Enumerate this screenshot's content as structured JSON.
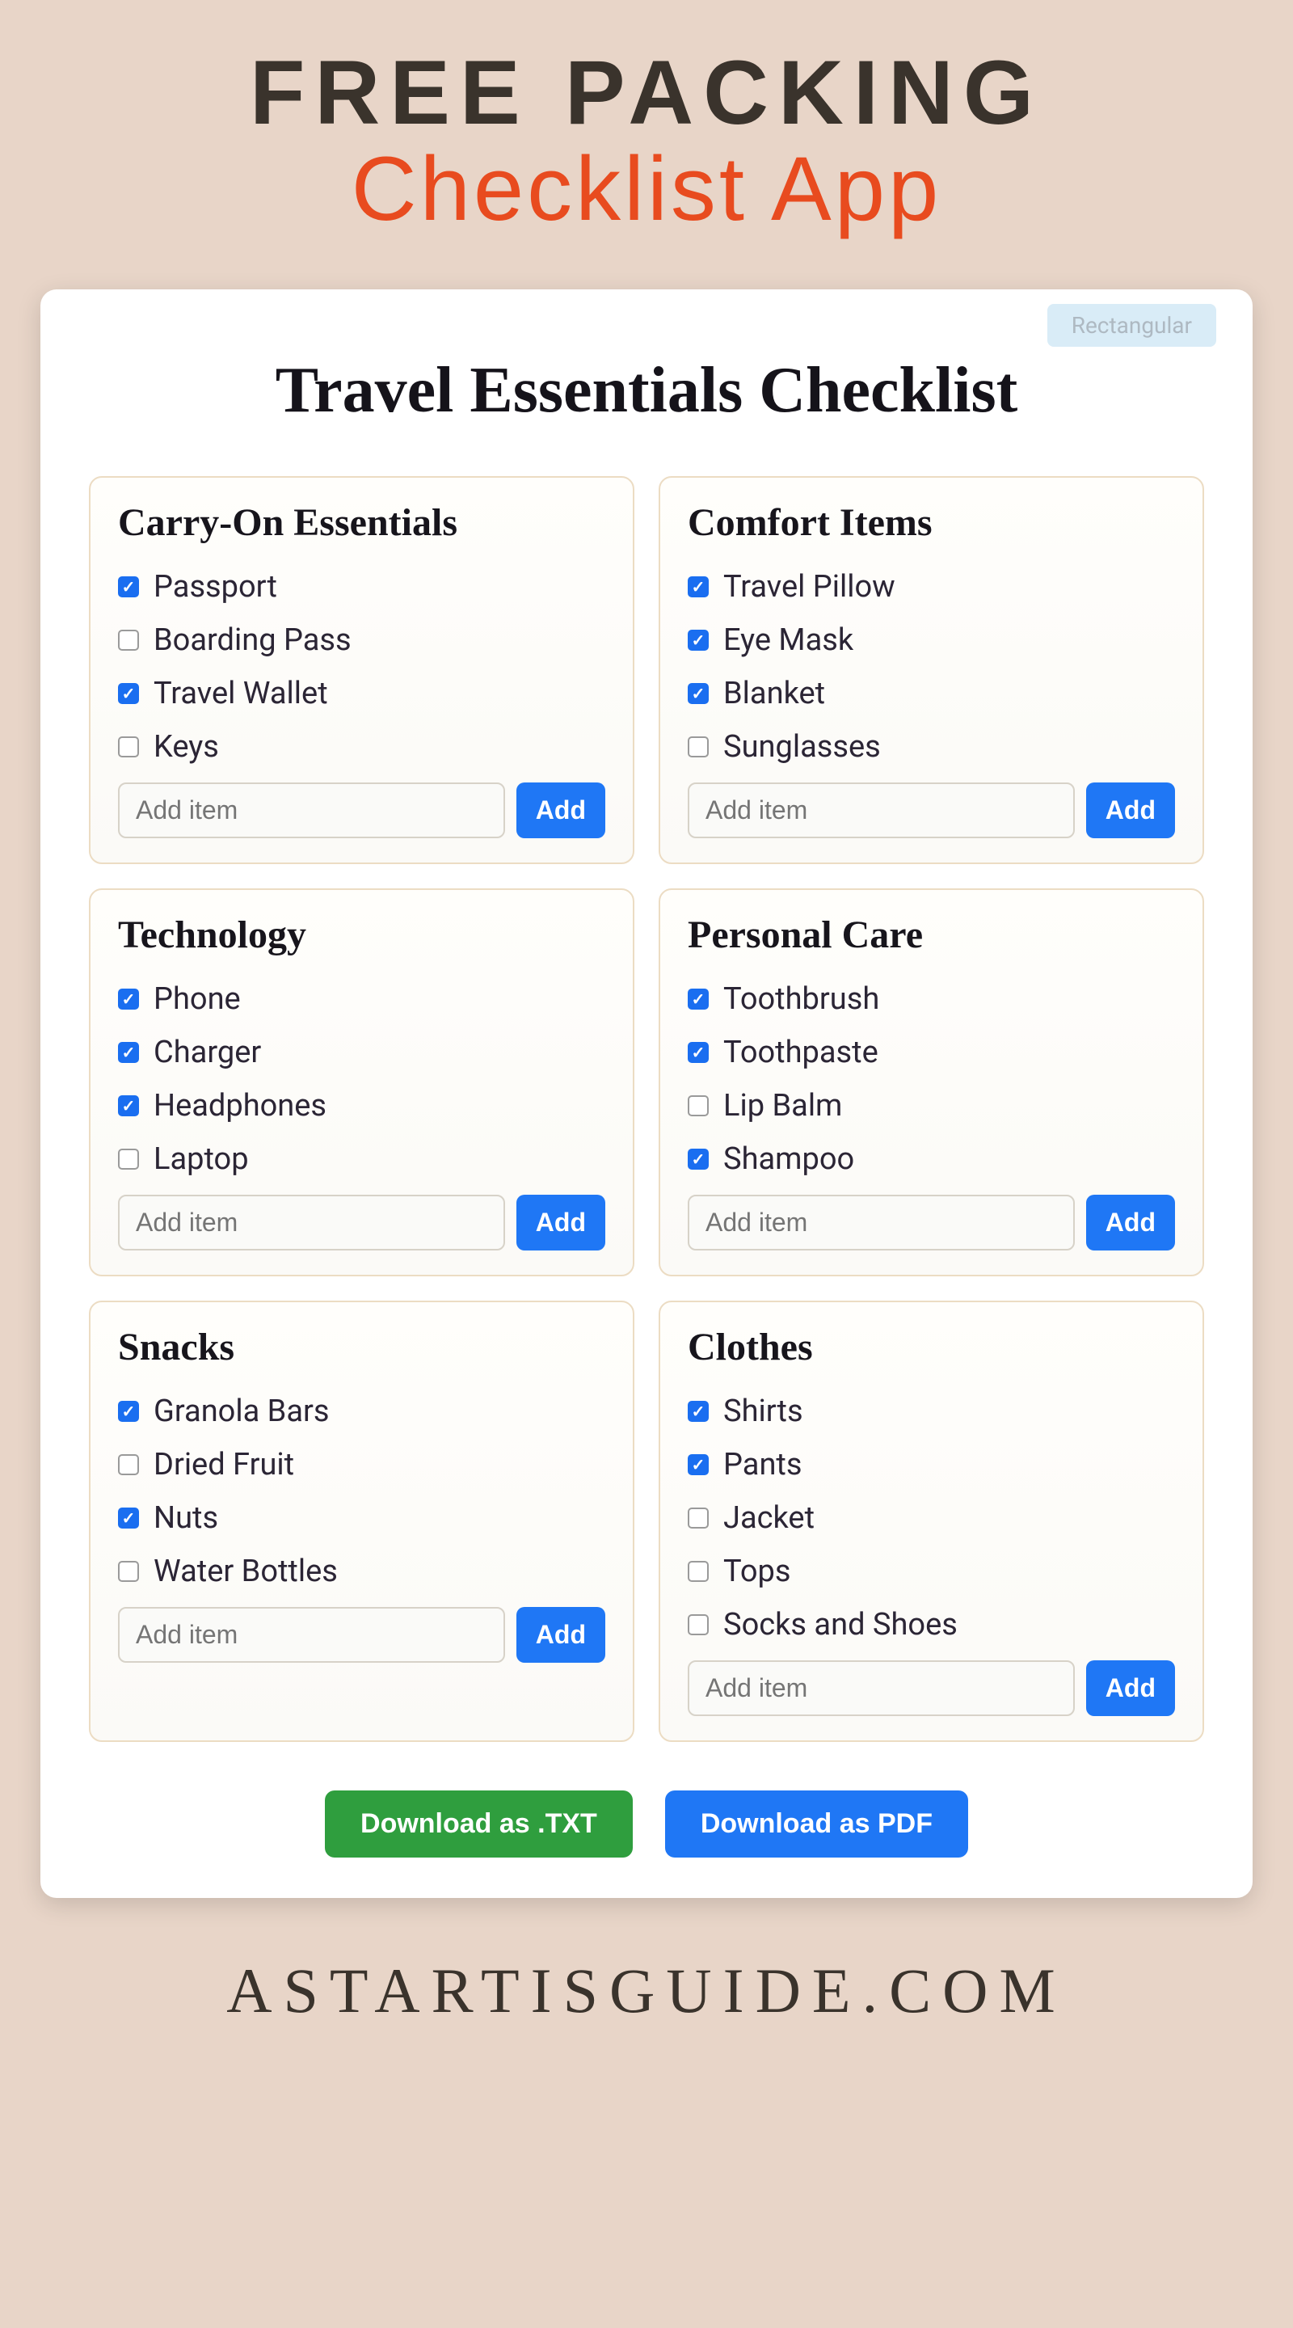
{
  "header": {
    "line1": "FREE PACKING",
    "line2": "Checklist App"
  },
  "badge": "Rectangular",
  "appTitle": "Travel Essentials Checklist",
  "groups": [
    {
      "title": "Carry-On Essentials",
      "items": [
        {
          "label": "Passport",
          "checked": true
        },
        {
          "label": "Boarding Pass",
          "checked": false
        },
        {
          "label": "Travel Wallet",
          "checked": true
        },
        {
          "label": "Keys",
          "checked": false
        }
      ]
    },
    {
      "title": "Comfort Items",
      "items": [
        {
          "label": "Travel Pillow",
          "checked": true
        },
        {
          "label": "Eye Mask",
          "checked": true
        },
        {
          "label": "Blanket",
          "checked": true
        },
        {
          "label": "Sunglasses",
          "checked": false
        }
      ]
    },
    {
      "title": "Technology",
      "items": [
        {
          "label": "Phone",
          "checked": true
        },
        {
          "label": "Charger",
          "checked": true
        },
        {
          "label": "Headphones",
          "checked": true
        },
        {
          "label": "Laptop",
          "checked": false
        }
      ]
    },
    {
      "title": "Personal Care",
      "items": [
        {
          "label": "Toothbrush",
          "checked": true
        },
        {
          "label": "Toothpaste",
          "checked": true
        },
        {
          "label": "Lip Balm",
          "checked": false
        },
        {
          "label": "Shampoo",
          "checked": true
        }
      ]
    },
    {
      "title": "Snacks",
      "items": [
        {
          "label": "Granola Bars",
          "checked": true
        },
        {
          "label": "Dried Fruit",
          "checked": false
        },
        {
          "label": "Nuts",
          "checked": true
        },
        {
          "label": "Water Bottles",
          "checked": false
        }
      ]
    },
    {
      "title": "Clothes",
      "items": [
        {
          "label": "Shirts",
          "checked": true
        },
        {
          "label": "Pants",
          "checked": true
        },
        {
          "label": "Jacket",
          "checked": false
        },
        {
          "label": "Tops",
          "checked": false
        },
        {
          "label": "Socks and Shoes",
          "checked": false
        }
      ]
    }
  ],
  "addItem": {
    "placeholder": "Add item",
    "button": "Add"
  },
  "download": {
    "txt": "Download as .TXT",
    "pdf": "Download as PDF"
  },
  "footer": "ASTARTISGUIDE.COM"
}
